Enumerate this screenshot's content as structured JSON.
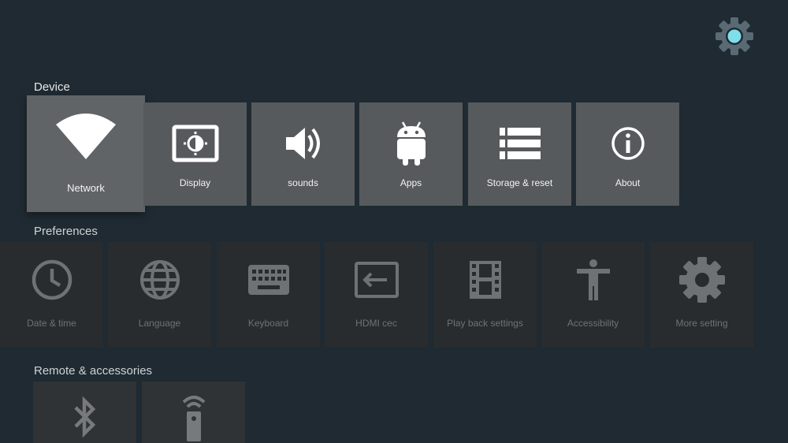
{
  "header": {
    "settings_icon": "gear-icon",
    "accent_color": "#80deea"
  },
  "sections": {
    "device": "Device",
    "preferences": "Preferences",
    "remote": "Remote & accessories"
  },
  "device_tiles": [
    {
      "label": "Network",
      "icon": "wifi-icon",
      "focused": true
    },
    {
      "label": "Display",
      "icon": "display-icon"
    },
    {
      "label": "sounds",
      "icon": "speaker-icon"
    },
    {
      "label": "Apps",
      "icon": "android-icon"
    },
    {
      "label": "Storage & reset",
      "icon": "storage-icon"
    },
    {
      "label": "About",
      "icon": "info-icon"
    }
  ],
  "preference_tiles": [
    {
      "label": "Date & time",
      "icon": "clock-icon"
    },
    {
      "label": "Language",
      "icon": "globe-icon"
    },
    {
      "label": "Keyboard",
      "icon": "keyboard-icon"
    },
    {
      "label": "HDMI cec",
      "icon": "input-icon"
    },
    {
      "label": "Play back settings",
      "icon": "film-icon"
    },
    {
      "label": "Accessibility",
      "icon": "accessibility-icon"
    },
    {
      "label": "More setting",
      "icon": "gear-icon"
    }
  ],
  "remote_tiles": [
    {
      "icon": "bluetooth-icon"
    },
    {
      "icon": "remote-control-icon"
    }
  ]
}
